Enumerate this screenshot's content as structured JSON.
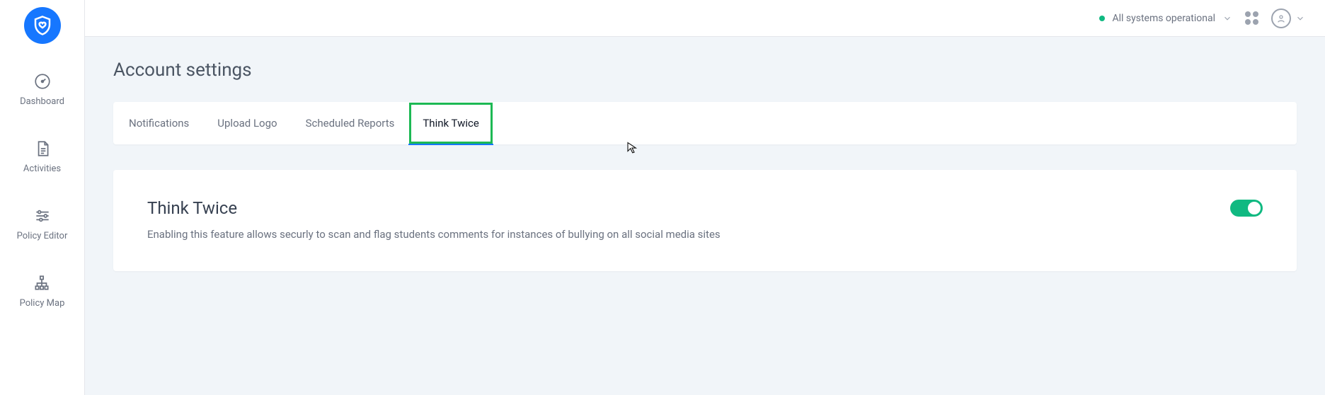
{
  "header": {
    "status_text": "All systems operational"
  },
  "sidebar": {
    "items": [
      {
        "label": "Dashboard"
      },
      {
        "label": "Activities"
      },
      {
        "label": "Policy Editor"
      },
      {
        "label": "Policy Map"
      }
    ]
  },
  "page": {
    "title": "Account settings"
  },
  "tabs": [
    {
      "label": "Notifications"
    },
    {
      "label": "Upload Logo"
    },
    {
      "label": "Scheduled Reports"
    },
    {
      "label": "Think Twice"
    }
  ],
  "panel": {
    "title": "Think Twice",
    "description": "Enabling this feature allows securly to scan and flag students comments for instances of bullying on all social media sites",
    "toggle_on": true
  }
}
